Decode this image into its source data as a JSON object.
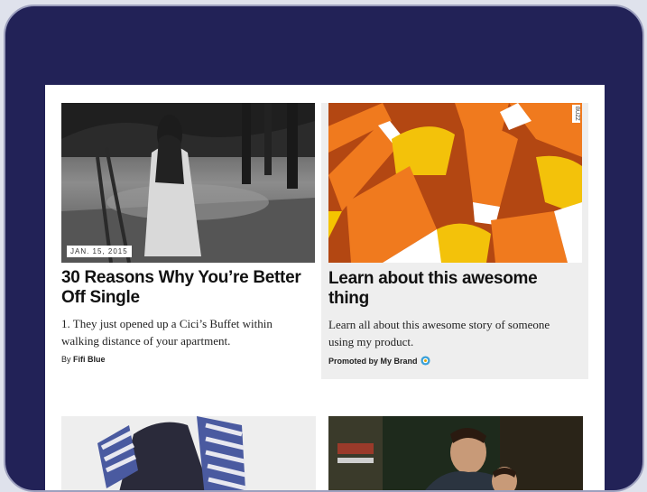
{
  "cards": [
    {
      "date": "JAN. 15, 2015",
      "title": "30 Reasons Why You’re Better Off Single",
      "description": "1. They just opened up a Cici’s Buffet within walking distance of your apartment.",
      "byline_prefix": "By",
      "author": "Fifi Blue"
    },
    {
      "title": "Learn about this awesome thing",
      "description": "Learn all about this awesome story of someone using my product.",
      "promoted_label": "Promoted by My Brand",
      "corner_tag": "BUZZ"
    }
  ],
  "colors": {
    "frame": "#222257",
    "promoted_bg": "#eeeeee"
  }
}
